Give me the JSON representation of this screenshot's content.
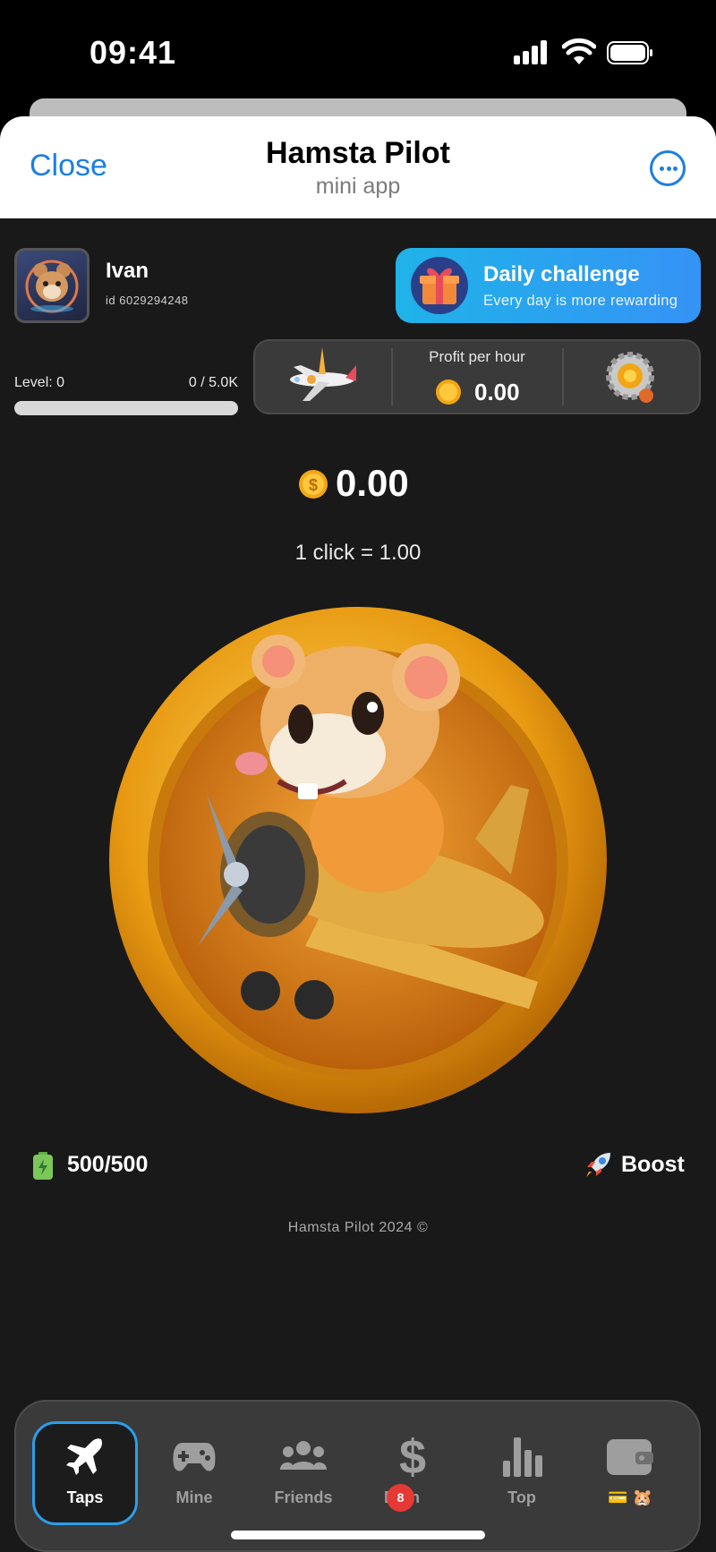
{
  "status_bar": {
    "time": "09:41"
  },
  "sheet": {
    "close_label": "Close",
    "title": "Hamsta Pilot",
    "subtitle": "mini app"
  },
  "user": {
    "name": "Ivan",
    "id_text": "id 6029294248"
  },
  "daily_challenge": {
    "title": "Daily challenge",
    "subtitle": "Every day is more rewarding"
  },
  "level": {
    "label": "Level: 0",
    "progress_text": "0 / 5.0K",
    "fill_fraction": 0
  },
  "profit": {
    "label": "Profit per hour",
    "value": "0.00"
  },
  "balance": {
    "value": "0.00",
    "click_rate": "1 click = 1.00"
  },
  "energy": {
    "value": "500/500"
  },
  "boost": {
    "label": "Boost"
  },
  "footer": {
    "copyright": "Hamsta Pilot 2024 ©"
  },
  "nav": {
    "items": [
      {
        "label": "Taps",
        "icon": "airplane-icon",
        "active": true
      },
      {
        "label": "Mine",
        "icon": "gamepad-icon"
      },
      {
        "label": "Friends",
        "icon": "users-icon"
      },
      {
        "label": "Earn",
        "icon": "dollar-icon",
        "badge": "8"
      },
      {
        "label": "Top",
        "icon": "bar-chart-icon"
      },
      {
        "label": "💳 🐹",
        "icon": "wallet-icon"
      }
    ]
  },
  "colors": {
    "accent": "#1b7fe3",
    "challenge_start": "#1fb3e8",
    "challenge_end": "#3593f5",
    "coin": "#f2a515",
    "badge": "#e53935"
  }
}
